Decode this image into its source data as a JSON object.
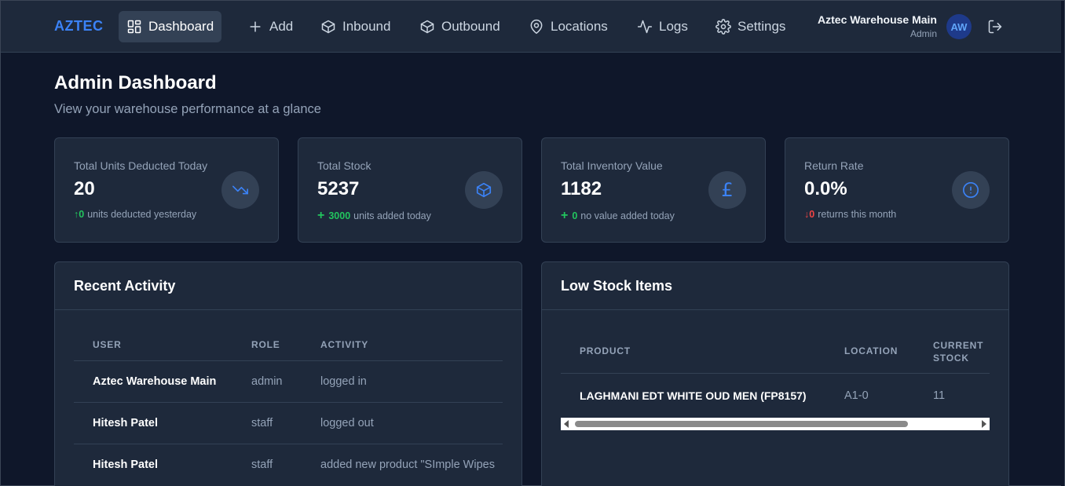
{
  "nav": {
    "brand": "AZTEC",
    "items": [
      {
        "label": "Dashboard",
        "icon": "grid-icon",
        "active": true
      },
      {
        "label": "Add",
        "icon": "plus-icon"
      },
      {
        "label": "Inbound",
        "icon": "box-icon"
      },
      {
        "label": "Outbound",
        "icon": "box-icon"
      },
      {
        "label": "Locations",
        "icon": "map-pin-icon"
      },
      {
        "label": "Logs",
        "icon": "activity-icon"
      },
      {
        "label": "Settings",
        "icon": "gear-icon"
      }
    ],
    "user_name": "Aztec Warehouse Main",
    "user_role": "Admin",
    "avatar_initials": "AW"
  },
  "header": {
    "title": "Admin Dashboard",
    "subtitle": "View your warehouse performance at a glance"
  },
  "stats": [
    {
      "label": "Total Units Deducted Today",
      "value": "20",
      "delta_prefix": "↑",
      "delta": "0",
      "delta_color": "#22c55e",
      "foot": "units deducted yesterday",
      "icon": "trending-down-icon"
    },
    {
      "label": "Total Stock",
      "value": "5237",
      "delta_prefix": "+",
      "delta": "3000",
      "delta_color": "#22c55e",
      "foot": "units added today",
      "icon": "box-icon"
    },
    {
      "label": "Total Inventory Value",
      "value": "1182",
      "delta_prefix": "+",
      "delta": "0",
      "delta_color": "#22c55e",
      "foot": "no value added today",
      "icon": "pound-icon",
      "glyph": "£"
    },
    {
      "label": "Return Rate",
      "value": "0.0%",
      "delta_prefix": "↓",
      "delta": "0",
      "delta_color": "#ef4444",
      "foot": "returns this month",
      "icon": "alert-circle-icon"
    }
  ],
  "recent_activity": {
    "title": "Recent Activity",
    "columns": [
      "User",
      "Role",
      "Activity"
    ],
    "rows": [
      {
        "user": "Aztec Warehouse Main",
        "role": "admin",
        "activity": "logged in"
      },
      {
        "user": "Hitesh Patel",
        "role": "staff",
        "activity": "logged out"
      },
      {
        "user": "Hitesh Patel",
        "role": "staff",
        "activity": "added new product \"SImple Wipes"
      }
    ]
  },
  "low_stock": {
    "title": "Low Stock Items",
    "columns": [
      "Product",
      "Location",
      "Current",
      "Stock"
    ],
    "rows": [
      {
        "product": "LAGHMANI EDT WHITE OUD MEN (FP8157)",
        "location": "A1-0",
        "stock": "11"
      }
    ]
  }
}
